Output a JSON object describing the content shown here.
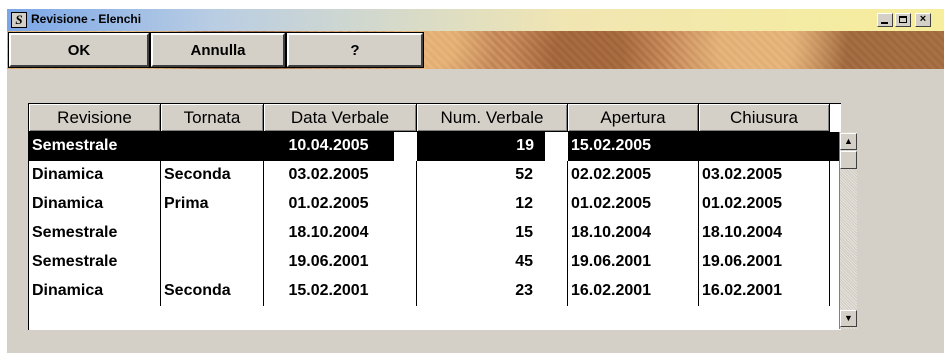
{
  "window": {
    "title": "Revisione - Elenchi",
    "icon": "S",
    "controls": {
      "minimize": "_",
      "close": "×"
    }
  },
  "toolbar": {
    "ok_label": "OK",
    "cancel_label": "Annulla",
    "help_label": "?"
  },
  "table": {
    "columns": [
      "Revisione",
      "Tornata",
      "Data Verbale",
      "Num. Verbale",
      "Apertura",
      "Chiusura"
    ],
    "rows": [
      {
        "revisione": "Semestrale",
        "tornata": "",
        "data_verbale": "10.04.2005",
        "num_verbale": "19",
        "apertura": "15.02.2005",
        "chiusura": ""
      },
      {
        "revisione": "Dinamica",
        "tornata": "Seconda",
        "data_verbale": "03.02.2005",
        "num_verbale": "52",
        "apertura": "02.02.2005",
        "chiusura": "03.02.2005"
      },
      {
        "revisione": "Dinamica",
        "tornata": "Prima",
        "data_verbale": "01.02.2005",
        "num_verbale": "12",
        "apertura": "01.02.2005",
        "chiusura": "01.02.2005"
      },
      {
        "revisione": "Semestrale",
        "tornata": "",
        "data_verbale": "18.10.2004",
        "num_verbale": "15",
        "apertura": "18.10.2004",
        "chiusura": "18.10.2004"
      },
      {
        "revisione": "Semestrale",
        "tornata": "",
        "data_verbale": "19.06.2001",
        "num_verbale": "45",
        "apertura": "19.06.2001",
        "chiusura": "19.06.2001"
      },
      {
        "revisione": "Dinamica",
        "tornata": "Seconda",
        "data_verbale": "15.02.2001",
        "num_verbale": "23",
        "apertura": "16.02.2001",
        "chiusura": "16.02.2001"
      }
    ],
    "selected_row": 0
  },
  "scrollbar": {
    "up_icon": "▲",
    "down_icon": "▼"
  },
  "colors": {
    "selection": "#000000",
    "face": "#d4d0c8"
  }
}
